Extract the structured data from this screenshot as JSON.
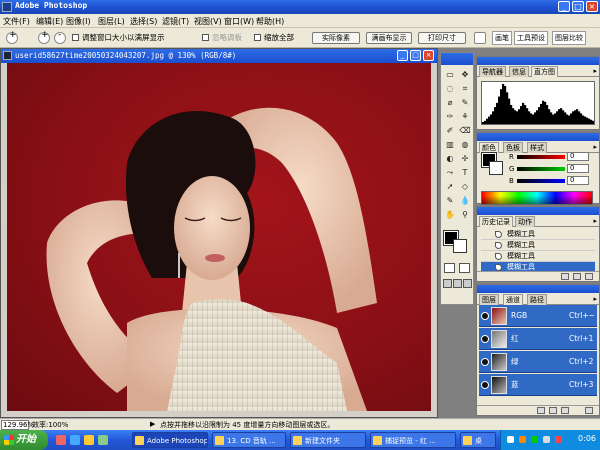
{
  "window": {
    "title": "Adobe Photoshop",
    "min": "_",
    "max": "□",
    "close": "×"
  },
  "menubar": {
    "items": [
      "文件(F)",
      "编辑(E)",
      "图像(I)",
      "图层(L)",
      "选择(S)",
      "滤镜(T)",
      "视图(V)",
      "窗口(W)",
      "帮助(H)"
    ]
  },
  "options": {
    "resize_window": "调整窗口大小以满屏显示",
    "ignore_palettes": "忽略调板",
    "zoom_all": "缩放全部",
    "actual_pixels": "实际像素",
    "fit_on_screen": "满画布显示",
    "print_size": "打印尺寸",
    "palette_tabs": [
      "画笔",
      "工具预设",
      "图层比较"
    ]
  },
  "document": {
    "title": "userid58627time20050324043207.jpg @ 130% (RGB/8#)",
    "min": "_",
    "max": "□",
    "close": "×"
  },
  "status": {
    "zoom": "129.96%",
    "efficiency": "效率:100%",
    "arrow": "▶",
    "hint": "点按并拖移以沿限制为 45 度增量方向移动图层或选区。"
  },
  "taskbar": {
    "start": "开始",
    "tasks": [
      "Adobe Photoshop",
      "13. CD 音轨 ...",
      "新建文件夹",
      "捕捉预览 - 红 ...",
      "桌"
    ],
    "clock": "0:06"
  },
  "toolbox": {
    "tools": [
      "▭",
      "✥",
      "◌",
      "⌗",
      "⌀",
      "✎",
      "✑",
      "⚘",
      "✐",
      "⌫",
      "▥",
      "◍",
      "◐",
      "✢",
      "⤳",
      "T",
      "➚",
      "◇",
      "✎",
      "💧",
      "✋",
      "⚲"
    ]
  },
  "navigator": {
    "tabs": [
      "导航器",
      "信息",
      "直方图"
    ],
    "histogram_heights": [
      2,
      3,
      5,
      7,
      9,
      12,
      16,
      20,
      26,
      33,
      38,
      36,
      30,
      24,
      18,
      15,
      13,
      12,
      14,
      17,
      20,
      18,
      15,
      12,
      10,
      9,
      11,
      13,
      16,
      19,
      22,
      21,
      18,
      14,
      11,
      9,
      10,
      12,
      14,
      15,
      13,
      11,
      9,
      8,
      10,
      12,
      13,
      14,
      12,
      10,
      8,
      7,
      6,
      5,
      4,
      3
    ]
  },
  "color": {
    "tabs": [
      "颜色",
      "色板",
      "样式"
    ],
    "channels": [
      {
        "label": "R",
        "value": "0",
        "color": "#d22"
      },
      {
        "label": "G",
        "value": "0",
        "color": "#2a2"
      },
      {
        "label": "B",
        "value": "0",
        "color": "#22d"
      }
    ]
  },
  "history": {
    "tabs": [
      "历史记录",
      "动作"
    ],
    "rows": [
      "模糊工具",
      "模糊工具",
      "模糊工具",
      "模糊工具"
    ]
  },
  "channels": {
    "tabs": [
      "图层",
      "通道",
      "路径"
    ],
    "rows": [
      {
        "name": "RGB",
        "shortcut": "Ctrl+~"
      },
      {
        "name": "红",
        "shortcut": "Ctrl+1"
      },
      {
        "name": "绿",
        "shortcut": "Ctrl+2"
      },
      {
        "name": "蓝",
        "shortcut": "Ctrl+3"
      }
    ]
  }
}
